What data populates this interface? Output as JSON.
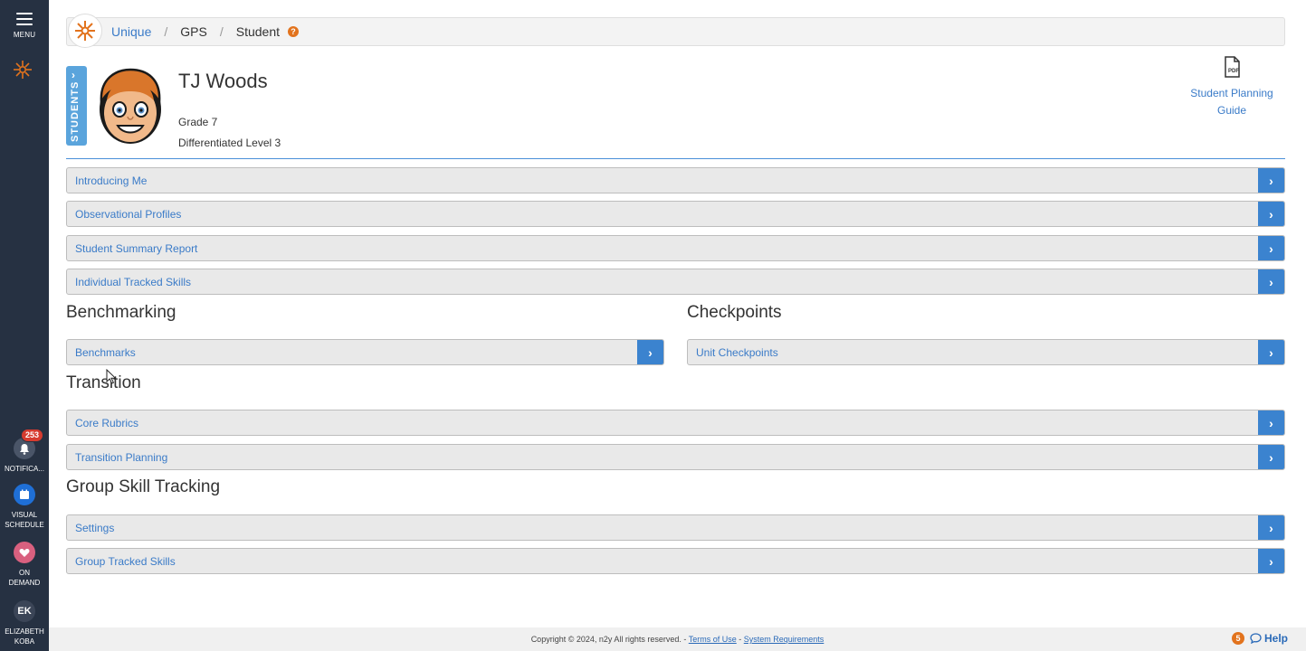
{
  "sidebar": {
    "menu_label": "MENU",
    "notifications": {
      "label": "NOTIFICA...",
      "badge": "253"
    },
    "visual_schedule": {
      "label_line1": "VISUAL",
      "label_line2": "SCHEDULE"
    },
    "on_demand": {
      "label_line1": "ON",
      "label_line2": "DEMAND"
    },
    "user": {
      "initials": "EK",
      "label_line1": "ELIZABETH",
      "label_line2": "KOBA"
    }
  },
  "breadcrumb": {
    "home": "Unique",
    "section": "GPS",
    "page": "Student",
    "help_glyph": "?"
  },
  "student": {
    "tab_label": "STUDENTS",
    "name": "TJ Woods",
    "grade": "Grade 7",
    "level": "Differentiated Level 3"
  },
  "guide": {
    "line1": "Student Planning",
    "line2": "Guide"
  },
  "panels": {
    "introducing_me": "Introducing Me",
    "observational_profiles": "Observational Profiles",
    "student_summary_report": "Student Summary Report",
    "individual_tracked_skills": "Individual Tracked Skills",
    "benchmarks": "Benchmarks",
    "unit_checkpoints": "Unit Checkpoints",
    "core_rubrics": "Core Rubrics",
    "transition_planning": "Transition Planning",
    "settings": "Settings",
    "group_tracked_skills": "Group Tracked Skills"
  },
  "sections": {
    "benchmarking": "Benchmarking",
    "checkpoints": "Checkpoints",
    "transition": "Transition",
    "group_skill_tracking": "Group Skill Tracking"
  },
  "footer": {
    "copyright": "Copyright © 2024, n2y All rights reserved. - ",
    "terms": "Terms of Use",
    "separator": " - ",
    "system_requirements": "System Requirements",
    "help_count": "5",
    "help_label": "Help"
  },
  "colors": {
    "accent": "#3b83cf",
    "link": "#3a7bc8",
    "sidebar": "#263142",
    "brand_orange": "#e2731d"
  }
}
